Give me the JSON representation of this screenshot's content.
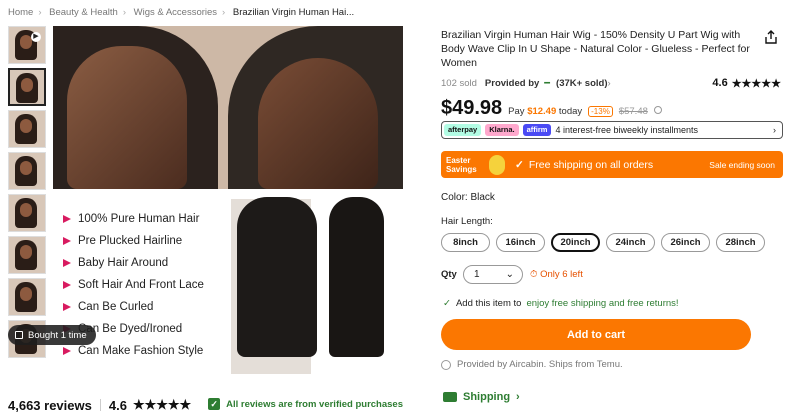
{
  "breadcrumb": [
    "Home",
    "Beauty & Health",
    "Wigs & Accessories",
    "Brazilian Virgin Human Hai..."
  ],
  "gallery": {
    "bought_badge": "Bought 1 time",
    "features": [
      "100% Pure Human Hair",
      "Pre Plucked Hairline",
      "Baby Hair Around",
      "Soft Hair And Front Lace",
      "Can Be Curled",
      "Can Be Dyed/Ironed",
      "Can Make Fashion Style"
    ]
  },
  "reviews": {
    "count_label": "4,663 reviews",
    "score": "4.6",
    "stars": "★★★★★",
    "verified": "All reviews are from verified purchases"
  },
  "product": {
    "title": "Brazilian Virgin Human Hair Wig - 150% Density U Part Wig with Body Wave Clip In U Shape - Natural Color - Glueless - Perfect for Women",
    "sold": "102 sold",
    "provided_by": "Provided by",
    "store_sold": "(37K+ sold)",
    "rating_score": "4.6",
    "price": "$49.98",
    "pay_label": "Pay",
    "pay_today": "$12.49",
    "today_label": "today",
    "discount": "-13%",
    "old_price": "$57.48",
    "bnpl_text": "4 interest-free biweekly installments",
    "bnpl_logos": [
      "afterpay",
      "Klarna.",
      "affirm"
    ],
    "promo_label1": "Easter",
    "promo_label2": "Savings",
    "promo_text": "Free shipping on all orders",
    "promo_sale": "Sale ending soon",
    "color_label": "Color: Black",
    "hair_length_label": "Hair Length:",
    "lengths": [
      "8inch",
      "16inch",
      "20inch",
      "24inch",
      "26inch",
      "28inch"
    ],
    "selected_length": "20inch",
    "qty_label": "Qty",
    "qty_value": "1",
    "stock": "Only 6 left",
    "ship_text_prefix": "Add this item to",
    "ship_text_green": "enjoy free shipping and free returns!",
    "cart_button": "Add to cart",
    "provided_text": "Provided by Aircabin. Ships from Temu.",
    "shipping_label": "Shipping"
  }
}
